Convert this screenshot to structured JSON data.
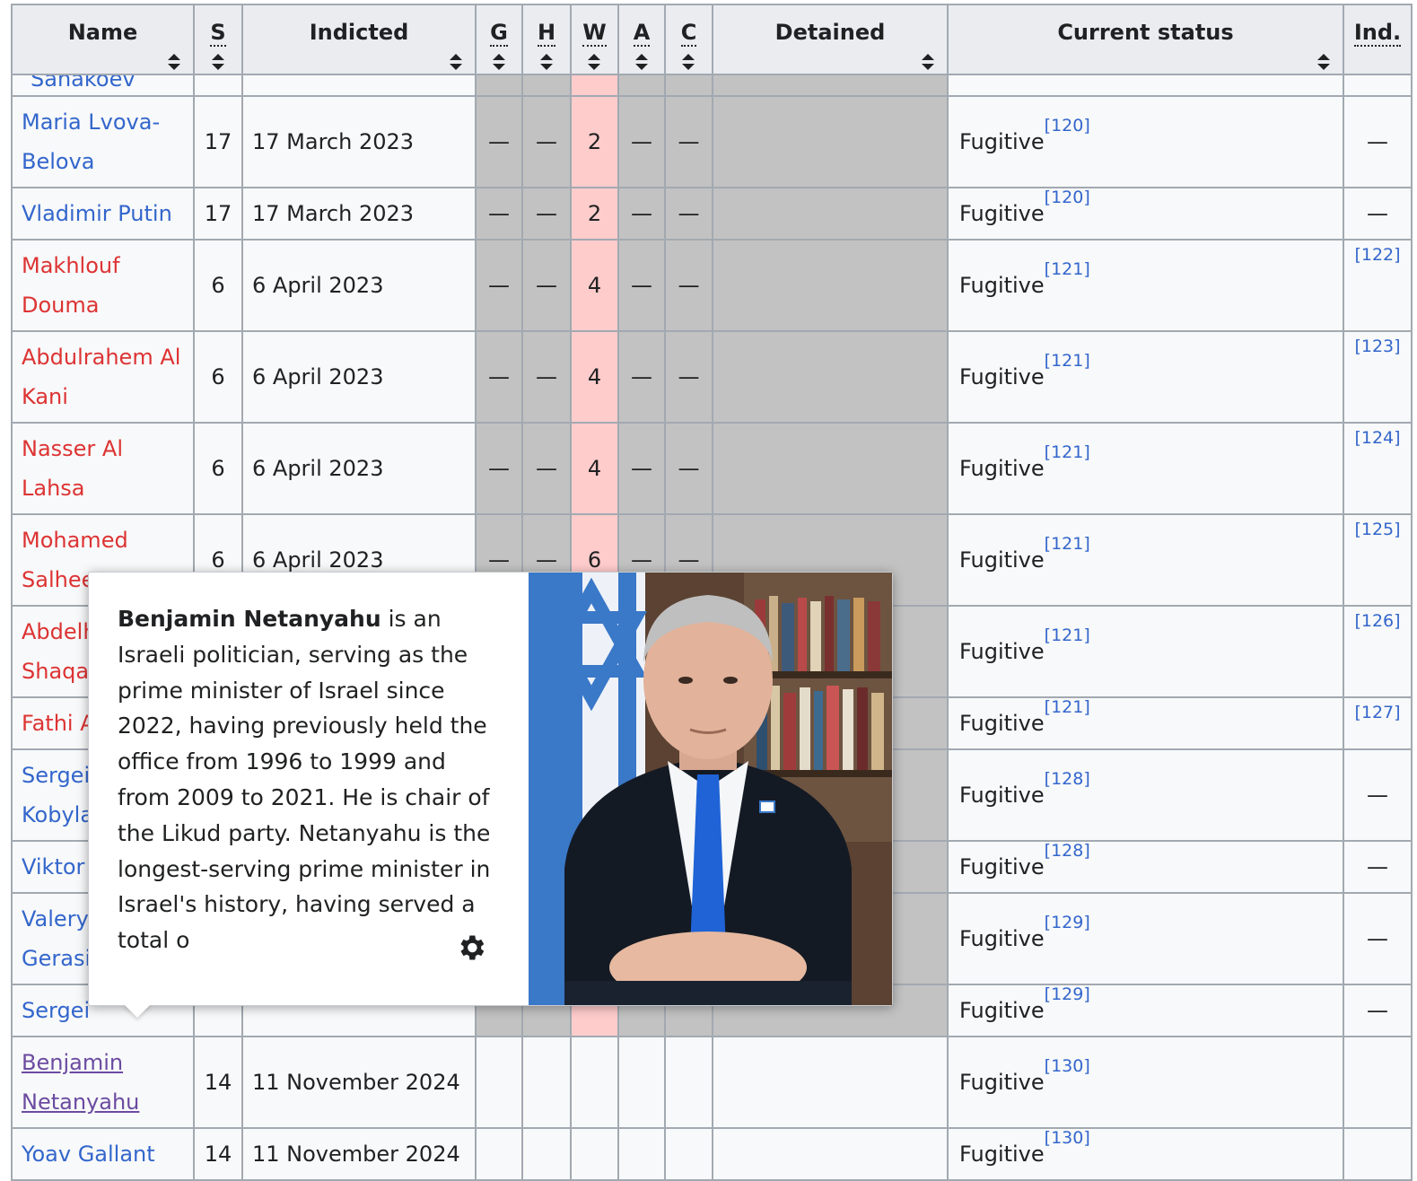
{
  "headers": {
    "name": "Name",
    "s": "S",
    "indicted": "Indicted",
    "g": "G",
    "h": "H",
    "w": "W",
    "a": "A",
    "c": "C",
    "detained": "Detained",
    "status": "Current status",
    "ind": "Ind."
  },
  "cut_row_name": "Sanakoev",
  "rows": [
    {
      "name": "Maria Lvova-Belova",
      "s": "17",
      "date": "17 March 2023",
      "g": "—",
      "h": "—",
      "w": "2",
      "a": "—",
      "c": "—",
      "status": "Fugitive",
      "ref": "[120]",
      "ind": "—"
    },
    {
      "name": "Vladimir Putin",
      "s": "17",
      "date": "17 March 2023",
      "g": "—",
      "h": "—",
      "w": "2",
      "a": "—",
      "c": "—",
      "status": "Fugitive",
      "ref": "[120]",
      "ind": "—"
    },
    {
      "name": "Makhlouf Douma",
      "s": "6",
      "date": "6 April 2023",
      "g": "—",
      "h": "—",
      "w": "4",
      "a": "—",
      "c": "—",
      "status": "Fugitive",
      "ref": "[121]",
      "ind": "[122]"
    },
    {
      "name": "Abdulrahem Al Kani",
      "s": "6",
      "date": "6 April 2023",
      "g": "—",
      "h": "—",
      "w": "4",
      "a": "—",
      "c": "—",
      "status": "Fugitive",
      "ref": "[121]",
      "ind": "[123]"
    },
    {
      "name": "Nasser Al Lahsa",
      "s": "6",
      "date": "6 April 2023",
      "g": "—",
      "h": "—",
      "w": "4",
      "a": "—",
      "c": "—",
      "status": "Fugitive",
      "ref": "[121]",
      "ind": "[124]"
    },
    {
      "name": "Mohamed Salheen",
      "s": "6",
      "date": "6 April 2023",
      "g": "—",
      "h": "—",
      "w": "6",
      "a": "—",
      "c": "—",
      "status": "Fugitive",
      "ref": "[121]",
      "ind": "[125]"
    },
    {
      "name": "Abdelhakim Shaqar",
      "s": "",
      "date": "",
      "g": "",
      "h": "",
      "w": "",
      "a": "",
      "c": "",
      "status": "Fugitive",
      "ref": "[121]",
      "ind": "[126]"
    },
    {
      "name": "Fathi Al",
      "s": "",
      "date": "",
      "g": "",
      "h": "",
      "w": "",
      "a": "",
      "c": "",
      "status": "Fugitive",
      "ref": "[121]",
      "ind": "[127]"
    },
    {
      "name": "Sergei Kobylash",
      "s": "",
      "date": "",
      "g": "",
      "h": "",
      "w": "",
      "a": "",
      "c": "",
      "status": "Fugitive",
      "ref": "[128]",
      "ind": "—"
    },
    {
      "name": "Viktor",
      "s": "",
      "date": "",
      "g": "",
      "h": "",
      "w": "",
      "a": "",
      "c": "",
      "status": "Fugitive",
      "ref": "[128]",
      "ind": "—"
    },
    {
      "name": "Valery Gerasimov",
      "s": "",
      "date": "",
      "g": "",
      "h": "",
      "w": "",
      "a": "",
      "c": "",
      "status": "Fugitive",
      "ref": "[129]",
      "ind": "—"
    },
    {
      "name": "Sergei",
      "s": "",
      "date": "",
      "g": "",
      "h": "",
      "w": "",
      "a": "",
      "c": "",
      "status": "Fugitive",
      "ref": "[129]",
      "ind": "—"
    },
    {
      "name": "Benjamin Netanyahu",
      "s": "14",
      "date": "11 November 2024",
      "g": "",
      "h": "",
      "w": "",
      "a": "",
      "c": "",
      "status": "Fugitive",
      "ref": "[130]",
      "ind": ""
    },
    {
      "name": "Yoav Gallant",
      "s": "14",
      "date": "11 November 2024",
      "g": "",
      "h": "",
      "w": "",
      "a": "",
      "c": "",
      "status": "Fugitive",
      "ref": "[130]",
      "ind": ""
    }
  ],
  "popup": {
    "title": "Benjamin Netanyahu",
    "extract": " is an Israeli politician, serving as the prime minister of Israel since 2022, having previously held the office from 1996 to 1999 and from 2009 to 2021. He is chair of the Likud party. Netanyahu is the longest-serving prime minister in Israel's history, having served a total o",
    "settings_icon": "gear-icon"
  },
  "colors": {
    "link": "#3366cc",
    "redlink": "#d33",
    "visited": "#6b4ba1",
    "war_crimes_highlight": "#ffcccc",
    "not_applicable_gray": "#c2c2c2"
  }
}
